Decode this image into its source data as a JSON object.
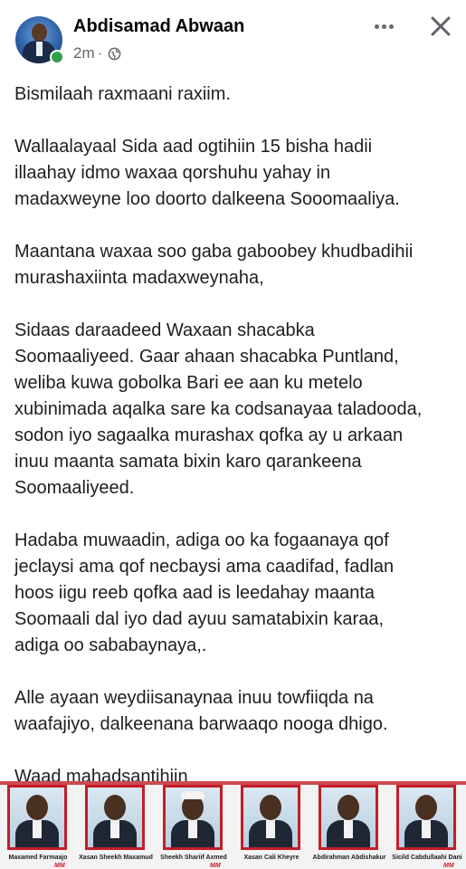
{
  "header": {
    "author": "Abdisamad Abwaan",
    "time": "2m",
    "separator": "·",
    "icons": {
      "privacy": "globe-icon",
      "more": "more-options-icon",
      "close": "close-icon",
      "presence": "online-status-dot"
    }
  },
  "post": {
    "paragraphs": [
      "Bismilaah raxmaani raxiim.",
      "Wallaalayaal Sida aad ogtihiin 15 bisha hadii\nillaahay idmo waxaa qorshuhu yahay in\nmadaxweyne loo doorto dalkeena Sooomaaliya.",
      "Maantana waxaa soo gaba gaboobey  khudbadihii\nmurashaxiinta madaxweynaha,",
      "Sidaas daraadeed Waxaan shacabka\nSoomaaliyeed. Gaar ahaan shacabka Puntland,\nweliba kuwa gobolka Bari ee aan ku metelo\nxubinimada aqalka sare  ka codsanayaa taladooda,\nsodon iyo sagaalka murashax qofka ay u arkaan\ninuu maanta samata bixin karo qarankeena\nSoomaaliyeed.",
      "Hadaba muwaadin, adiga oo ka fogaanaya qof\njeclaysi ama qof necbaysi ama caadifad, fadlan\nhoos iigu reeb qofka aad is leedahay maanta\nSoomaali dal iyo dad ayuu samatabixin karaa,\nadiga oo sababaynaya,.",
      "Alle ayaan weydiisanaynaa inuu towfiiqda na\nwaafajiyo, dalkeenana barwaaqo nooga dhigo.",
      "Waad mahadsantihiin\nSenoter Abdisamad Yusuf Mohamed(abwaan)"
    ]
  },
  "candidates": [
    {
      "name": "Maxamed Farmaajo",
      "logo": "MM"
    },
    {
      "name": "Xasan Sheekh Maxamud",
      "logo": ""
    },
    {
      "name": "Sheekh Shariif Axmed",
      "logo": "MM"
    },
    {
      "name": "Xasan Cali Kheyre",
      "logo": ""
    },
    {
      "name": "Abdirahman Abdishakur",
      "logo": ""
    },
    {
      "name": "Sicild Cabdullaahi Dani",
      "logo": "MM"
    }
  ],
  "colors": {
    "brand_red": "#c41d27",
    "online_green": "#31a24c",
    "meta_gray": "#65676b"
  }
}
